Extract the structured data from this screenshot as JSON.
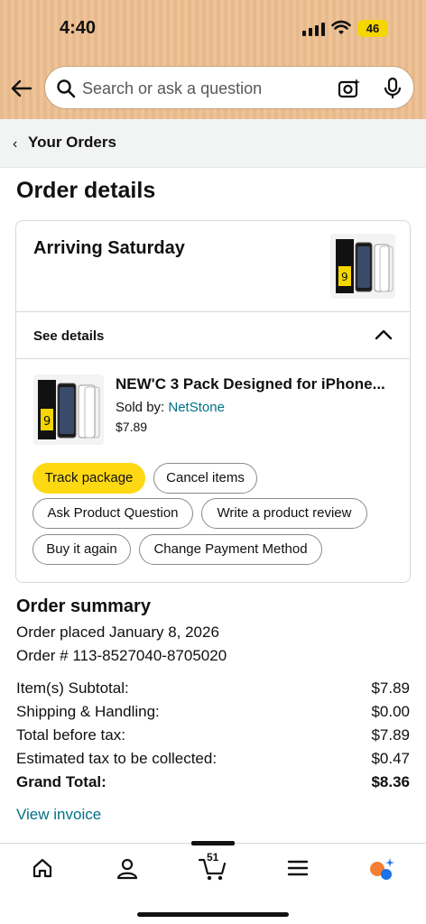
{
  "status_bar": {
    "time": "4:40",
    "battery": "46"
  },
  "search": {
    "placeholder": "Search or ask a question"
  },
  "breadcrumb": {
    "label": "Your Orders"
  },
  "page_title": "Order details",
  "shipment": {
    "arrival": "Arriving Saturday",
    "see_details": "See details",
    "product": {
      "title": "NEW'C 3 Pack Designed for iPhone...",
      "sold_by_label": "Sold by: ",
      "seller": "NetStone",
      "price": "$7.89"
    },
    "actions": [
      {
        "label": "Track package",
        "primary": true
      },
      {
        "label": "Cancel items"
      },
      {
        "label": "Ask Product Question"
      },
      {
        "label": "Write a product review"
      },
      {
        "label": "Buy it again"
      },
      {
        "label": "Change Payment Method"
      }
    ]
  },
  "summary": {
    "title": "Order summary",
    "placed": "Order placed January 8, 2026",
    "order_number": "Order # 113-8527040-8705020",
    "rows": [
      {
        "label": "Item(s) Subtotal:",
        "value": "$7.89"
      },
      {
        "label": "Shipping & Handling:",
        "value": "$0.00"
      },
      {
        "label": "Total before tax:",
        "value": "$7.89"
      },
      {
        "label": "Estimated tax to be collected:",
        "value": "$0.47"
      },
      {
        "label": "Grand Total:",
        "value": "$8.36"
      }
    ],
    "invoice_link": "View invoice"
  },
  "bottom_nav": {
    "items": [
      "home-icon",
      "account-icon",
      "cart-icon",
      "menu-icon",
      "rufus-icon"
    ],
    "cart_count": "51"
  },
  "colors": {
    "accent_yellow": "#ffd814",
    "link": "#007185",
    "header": "#e8b98b"
  }
}
